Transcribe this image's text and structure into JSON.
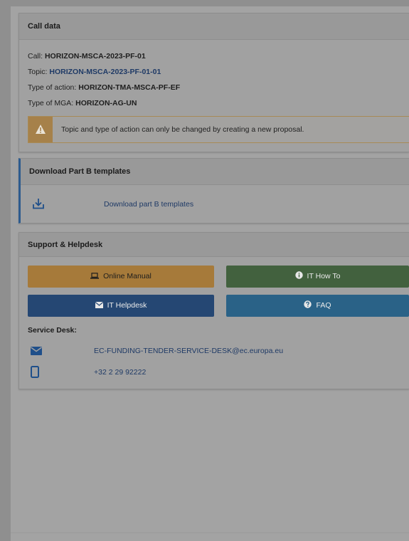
{
  "call_data": {
    "header": "Call data",
    "call_label": "Call: ",
    "call_value": "HORIZON-MSCA-2023-PF-01",
    "topic_label": "Topic: ",
    "topic_value": "HORIZON-MSCA-2023-PF-01-01",
    "action_label": "Type of action: ",
    "action_value": "HORIZON-TMA-MSCA-PF-EF",
    "mga_label": "Type of MGA: ",
    "mga_value": "HORIZON-AG-UN",
    "warning": "Topic and type of action can only be changed by creating a new proposal."
  },
  "download": {
    "header": "Download Part B templates",
    "link": "Download part B templates",
    "icon": "download-icon"
  },
  "support": {
    "header": "Support & Helpdesk",
    "buttons": {
      "manual": "Online Manual",
      "howto": "IT How To",
      "helpdesk": "IT Helpdesk",
      "faq": "FAQ"
    },
    "service_desk_title": "Service Desk:",
    "email": "EC-FUNDING-TENDER-SERVICE-DESK@ec.europa.eu",
    "phone": "+32 2 29 92222"
  },
  "colors": {
    "overlay": "#a3a3a3",
    "manual_btn": "#a67a3a",
    "howto_btn": "#42613e",
    "helpdesk_btn": "#254773",
    "faq_btn": "#2a6287",
    "link": "#1f3a66"
  }
}
